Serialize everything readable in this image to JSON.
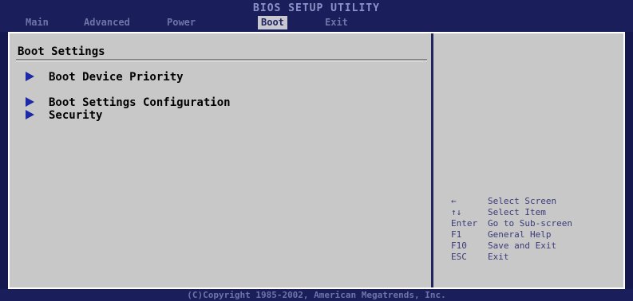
{
  "header": {
    "title": "BIOS SETUP UTILITY",
    "tabs": [
      {
        "label": "Main"
      },
      {
        "label": "Advanced"
      },
      {
        "label": "Power"
      },
      {
        "label": "Boot"
      },
      {
        "label": "Exit"
      }
    ]
  },
  "left": {
    "section_title": "Boot Settings",
    "items": [
      {
        "label": "Boot Device Priority"
      },
      {
        "label": "Boot Settings Configuration"
      },
      {
        "label": "Security"
      }
    ]
  },
  "help": {
    "rows": [
      {
        "key": "←",
        "desc": "Select Screen",
        "icon": "left-arrow-icon"
      },
      {
        "key": "↑↓",
        "desc": "Select Item",
        "icon": "up-down-arrows-icon"
      },
      {
        "key": "Enter",
        "desc": "Go to Sub-screen"
      },
      {
        "key": "F1",
        "desc": "General Help"
      },
      {
        "key": "F10",
        "desc": "Save and Exit"
      },
      {
        "key": "ESC",
        "desc": "Exit"
      }
    ]
  },
  "footer": {
    "copyright": "(C)Copyright 1985-2002, American Megatrends, Inc."
  },
  "colors": {
    "background": "#14184e",
    "panel": "#c8c8c8",
    "active_tab": "#c8c8d0",
    "arrow": "#1c2aa8"
  }
}
